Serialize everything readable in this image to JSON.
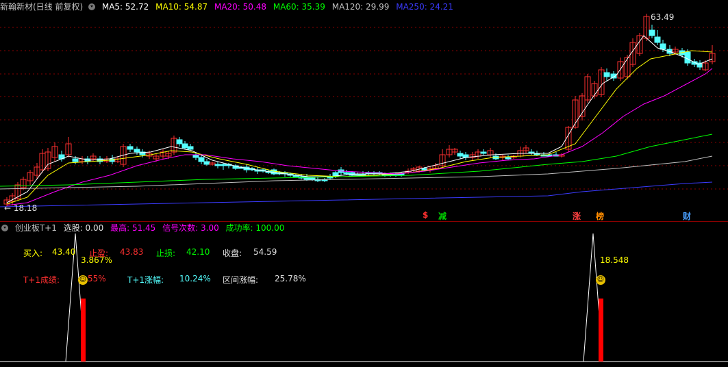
{
  "main": {
    "title": "新翰新材(日线 前复权)",
    "ma": [
      {
        "label": "MA5: 52.72",
        "color": "#ffffff"
      },
      {
        "label": "MA10: 54.87",
        "color": "#ffff00"
      },
      {
        "label": "MA20: 50.48",
        "color": "#ff00ff"
      },
      {
        "label": "MA60: 35.39",
        "color": "#00ff00"
      },
      {
        "label": "MA120: 29.99",
        "color": "#c0c0c0"
      },
      {
        "label": "MA250: 24.21",
        "color": "#3b3bff"
      }
    ],
    "high_label": "63.49",
    "low_label": "18.18",
    "markers": [
      {
        "text": "$",
        "color": "#ff3030"
      },
      {
        "text": "减",
        "color": "#00d000"
      },
      {
        "text": "涨",
        "color": "#ff4040"
      },
      {
        "text": "榜",
        "color": "#ff8c00"
      },
      {
        "text": "财",
        "color": "#4aa0ff"
      }
    ]
  },
  "sub": {
    "title": "创业板T+1",
    "xuangu": "选股: 0.00",
    "zuigao": "最高: 51.45",
    "xinhao": "信号次数: 3.00",
    "chenggong": "成功率: 100.00",
    "buy_label": "买入:",
    "buy_value": "43.40",
    "tp_label": "止盈:",
    "tp_value": "43.83",
    "sl_label": "止损:",
    "sl_value": "42.10",
    "close_label": "收盘:",
    "close_value": "54.59",
    "t1_perf_label": "T+1成绩:",
    "t1_perf_value": "55%",
    "t1_change_label": "T+1涨幅:",
    "t1_change_value": "10.24%",
    "range_change_label": "区间涨幅:",
    "range_change_value": "25.78%",
    "signal1_pct": "3.867%",
    "signal2_pct": "18.548"
  },
  "colors": {
    "up": "#ff3030",
    "down": "#54ffff",
    "grid": "#8b0000"
  }
}
